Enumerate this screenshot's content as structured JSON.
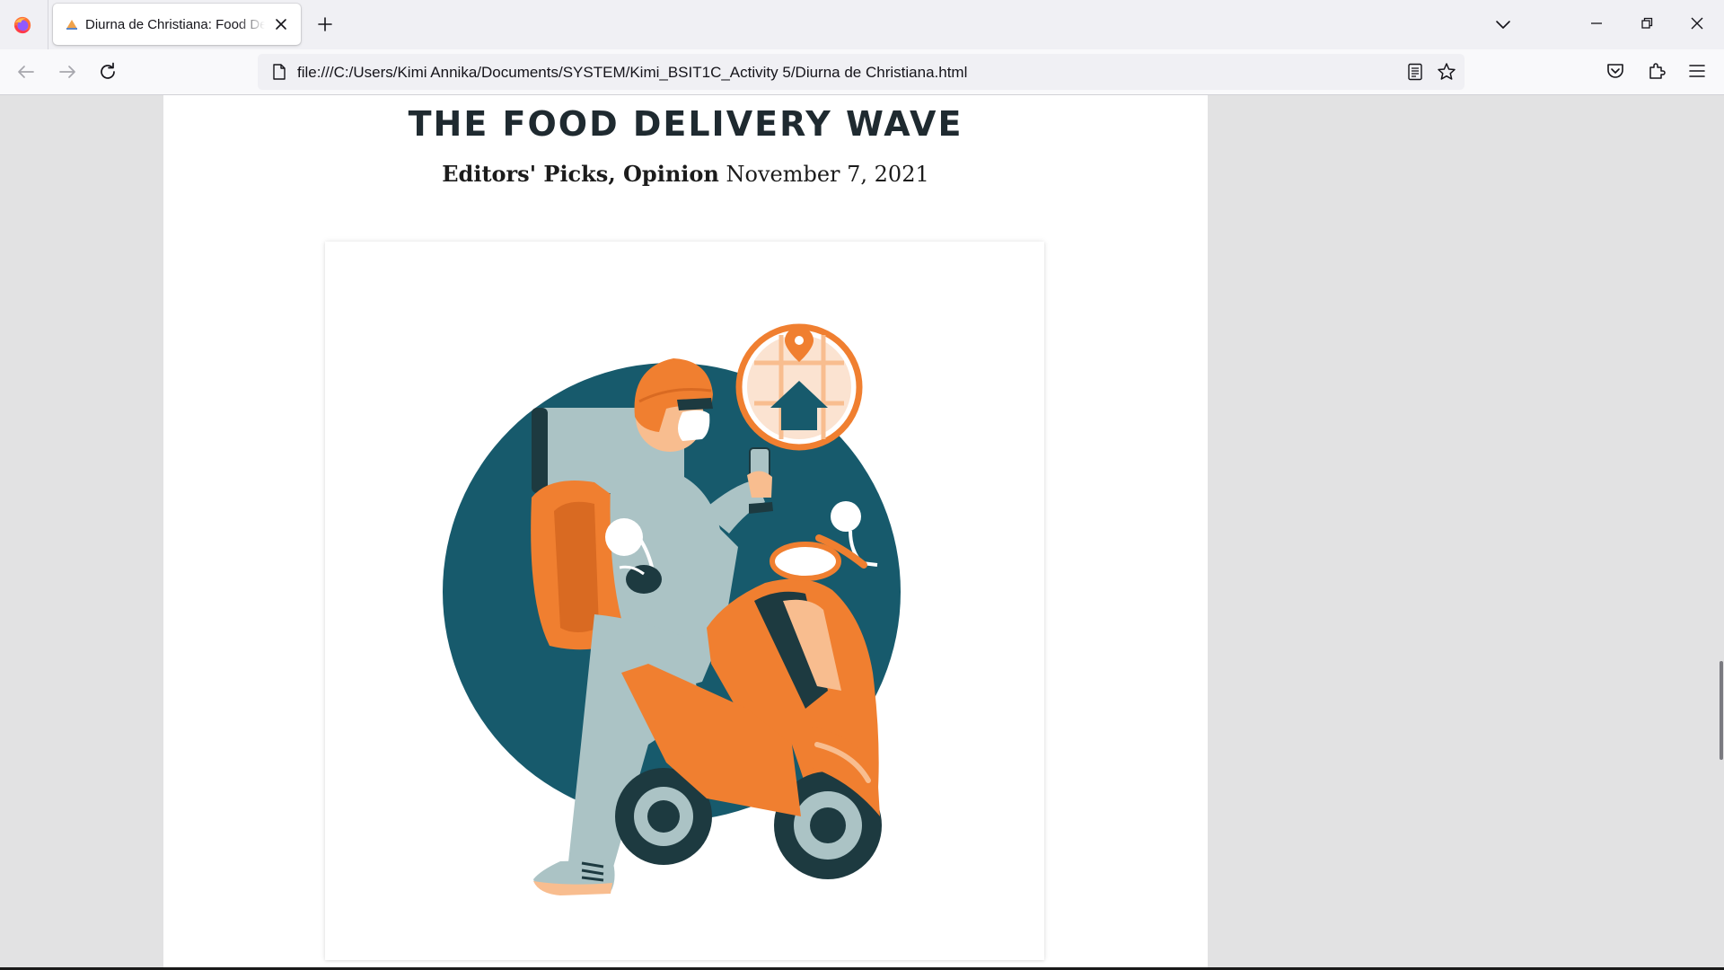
{
  "browser": {
    "tab": {
      "title": "Diurna de Christiana: Food Delivery Wave"
    },
    "url": "file:///C:/Users/Kimi Annika/Documents/SYSTEM/Kimi_BSIT1C_Activity 5/Diurna de Christiana.html"
  },
  "icons": {
    "tab_strip": [
      "firefox-logo",
      "favicon",
      "close-icon",
      "plus-icon",
      "chevron-down-icon",
      "minimize-icon",
      "restore-icon",
      "close-icon"
    ],
    "nav_bar": [
      "arrow-left-icon",
      "arrow-right-icon",
      "reload-icon",
      "page-icon",
      "reader-view-icon",
      "star-icon",
      "pocket-icon",
      "extensions-icon",
      "hamburger-menu-icon"
    ]
  },
  "article": {
    "headline": "THE FOOD DELIVERY WAVE",
    "categories": "Editors' Picks, Opinion",
    "date": "November 7, 2021"
  },
  "colors": {
    "teal": "#175a6c",
    "orange": "#f07f30",
    "peach": "#f8bd8f",
    "gray_blue": "#abc3c5",
    "dark": "#1d3a40"
  }
}
